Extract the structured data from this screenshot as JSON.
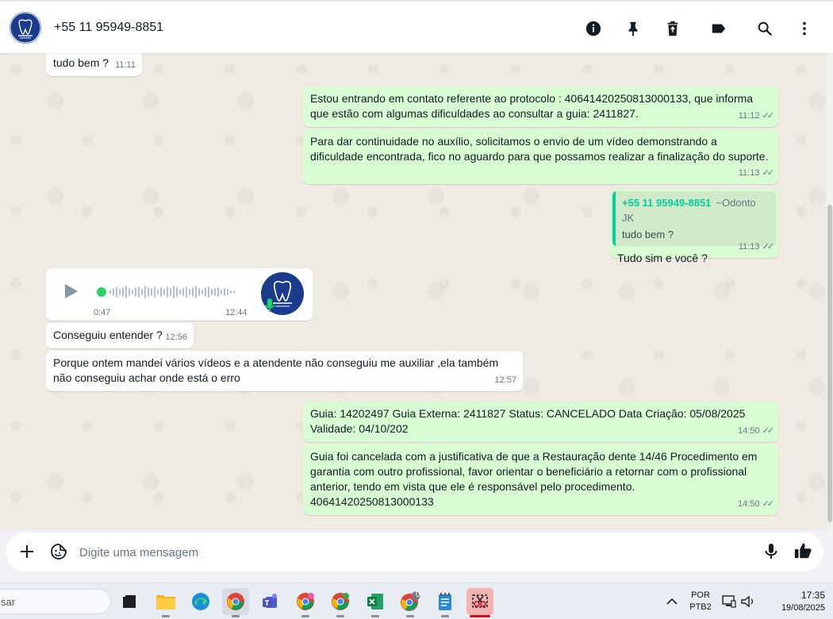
{
  "header": {
    "contact_name": "+55 11 95949-8851",
    "icons": [
      "info-icon",
      "pin-icon",
      "delete-icon",
      "label-icon",
      "search-icon",
      "more-vertical-icon"
    ]
  },
  "messages": [
    {
      "id": "m1",
      "direction": "in",
      "text": "tudo bem ?",
      "time": "11:11"
    },
    {
      "id": "m2",
      "direction": "out",
      "text": "Estou entrando em contato referente ao protocolo : 40641420250813000133, que informa\nque estão com algumas dificuldades ao consultar a guia: 2411827.",
      "time": "11:12"
    },
    {
      "id": "m3",
      "direction": "out",
      "text": "Para dar continuidade no auxílio, solicitamos o envio de um vídeo demonstrando a\ndificuldade encontrada, fico no aguardo para que possamos realizar a finalização do suporte.",
      "time": "11:13"
    },
    {
      "id": "m4",
      "direction": "out",
      "quote": {
        "author": "+55 11 95949-8851",
        "push_name": "~Odonto JK",
        "text": "tudo bem ?"
      },
      "text": "Tudo sim e você ?",
      "time": "11:13"
    },
    {
      "id": "m5",
      "direction": "in",
      "type": "audio",
      "duration": "0:47",
      "time": "12:44"
    },
    {
      "id": "m6",
      "direction": "in",
      "text": "Conseguiu entender ?",
      "time": "12:56"
    },
    {
      "id": "m7",
      "direction": "in",
      "text": "Porque ontem mandei vários vídeos e a atendente não conseguiu me auxiliar ,ela também\nnão conseguiu achar onde está o erro",
      "time": "12:57"
    },
    {
      "id": "m8",
      "direction": "out",
      "text": "Guia: 14202497 Guia Externa: 2411827 Status: CANCELADO Data Criação: 05/08/2025\nValidade: 04/10/202",
      "time": "14:50"
    },
    {
      "id": "m9",
      "direction": "out",
      "text": "Guia foi cancelada com a justificativa de que a Restauração dente 14/46 Procedimento em\ngarantia com outro profissional, favor orientar o beneficiário a retornar com o profissional\nanterior, tendo em vista que ele é responsável pelo procedimento.\n40641420250813000133",
      "time": "14:50"
    }
  ],
  "composer": {
    "placeholder": "Digite uma mensagem",
    "icons": [
      "plus-icon",
      "sticker-icon",
      "microphone-icon",
      "thumbs-up-icon"
    ]
  },
  "taskbar": {
    "search_text": "sar",
    "badge_count": "0",
    "language_top": "POR",
    "language_bottom": "PTB2",
    "clock_time": "17:35",
    "clock_date": "19/08/2025"
  },
  "colors": {
    "outgoing_bubble": "#d9fdd3",
    "incoming_bubble": "#ffffff",
    "chat_background": "#efeae2",
    "accent_green": "#06cf9c"
  }
}
